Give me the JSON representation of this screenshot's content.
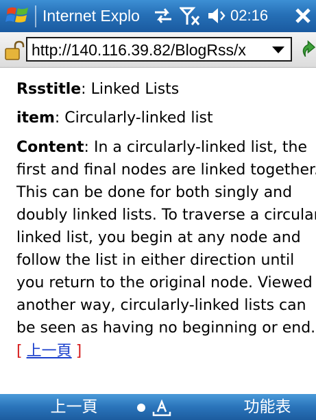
{
  "titlebar": {
    "app_title": "Internet Explo",
    "time": "02:16",
    "icons": [
      "windows-flag-icon",
      "connectivity-icon",
      "signal-off-icon",
      "volume-icon",
      "close-icon"
    ]
  },
  "addressbar": {
    "url": "http://140.116.39.82/BlogRss/x",
    "icons": [
      "lock-icon",
      "dropdown-arrow-icon",
      "go-arrow-icon"
    ]
  },
  "content": {
    "rsstitle_label": "Rsstitle",
    "rsstitle_value": ": Linked Lists",
    "item_label": "item",
    "item_value": ": Circularly-linked list",
    "content_label": "Content",
    "content_lines": [
      ": In a circularly-linked list, the",
      "first and final nodes are linked together.",
      "This can be done for both singly and",
      "doubly linked lists. To traverse a circular",
      "linked list, you begin at any node and",
      "follow the list in either direction until",
      "you return to the original node. Viewed",
      "another way, circularly-linked lists can",
      "be seen as having no beginning or end."
    ],
    "prev_open_bracket": "[",
    "prev_link": "上一頁",
    "prev_close_bracket": "]"
  },
  "softbar": {
    "left": "上一頁",
    "right": "功能表",
    "icons": [
      "input-dot-icon",
      "keyboard-input-icon"
    ]
  },
  "colors": {
    "titlebar_blue": "#2670b7",
    "link_blue": "#1a3fcc",
    "bracket_red": "#d61c1c"
  }
}
